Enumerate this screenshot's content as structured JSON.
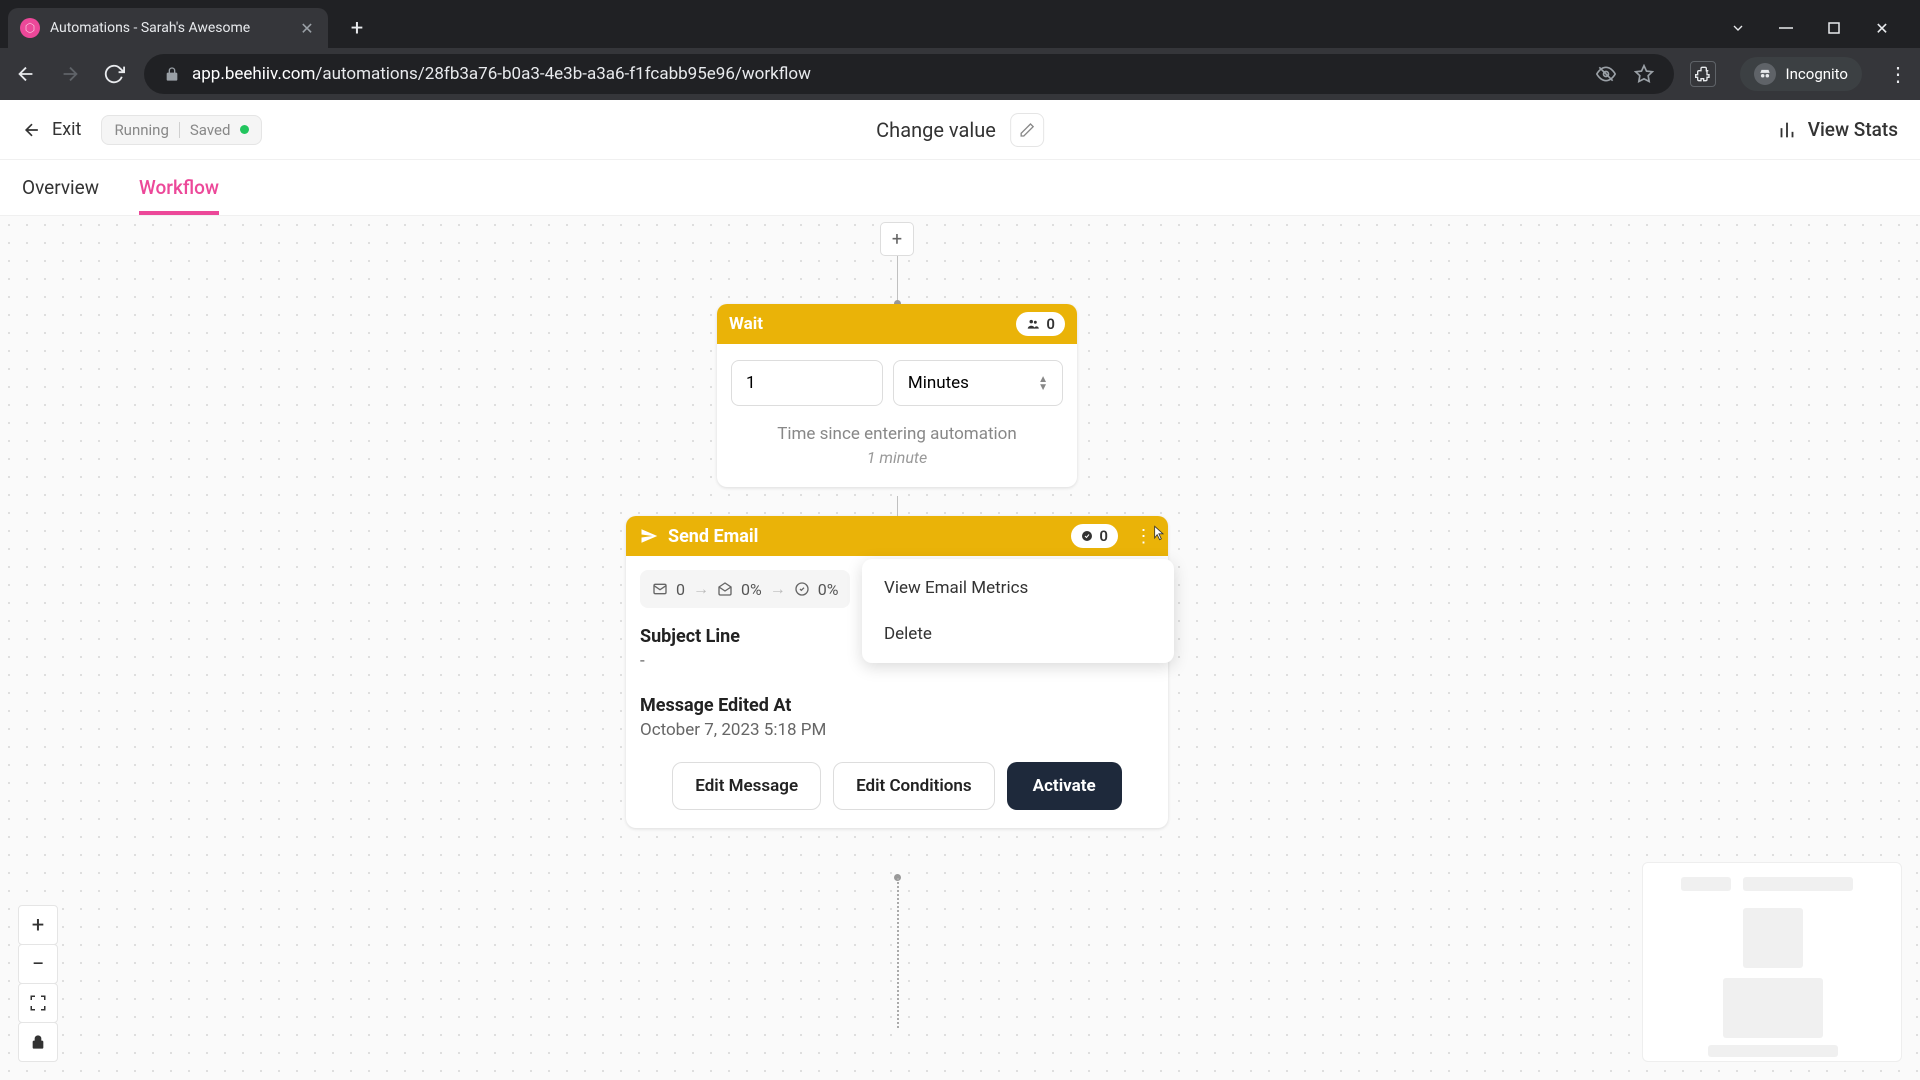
{
  "browser": {
    "tab_title": "Automations - Sarah's Awesome",
    "url_host": "app.beehiiv.com",
    "url_path": "/automations/28fb3a76-b0a3-4e3b-a3a6-f1fcabb95e96/workflow",
    "incognito_label": "Incognito"
  },
  "header": {
    "exit_label": "Exit",
    "status_running": "Running",
    "status_saved": "Saved",
    "page_title": "Change value",
    "view_stats_label": "View Stats"
  },
  "tabs": {
    "overview": "Overview",
    "workflow": "Workflow"
  },
  "wait_node": {
    "title": "Wait",
    "count": "0",
    "value": "1",
    "unit": "Minutes",
    "note": "Time since entering automation",
    "note_sub": "1 minute"
  },
  "email_node": {
    "title": "Send Email",
    "count": "0",
    "metric_sent": "0",
    "metric_open": "0%",
    "metric_click": "0%",
    "subject_label": "Subject Line",
    "subject_value": "-",
    "edited_label": "Message Edited At",
    "edited_value": "October 7, 2023 5:18 PM",
    "btn_edit_message": "Edit Message",
    "btn_edit_conditions": "Edit Conditions",
    "btn_activate": "Activate"
  },
  "context_menu": {
    "view_metrics": "View Email Metrics",
    "delete": "Delete"
  }
}
